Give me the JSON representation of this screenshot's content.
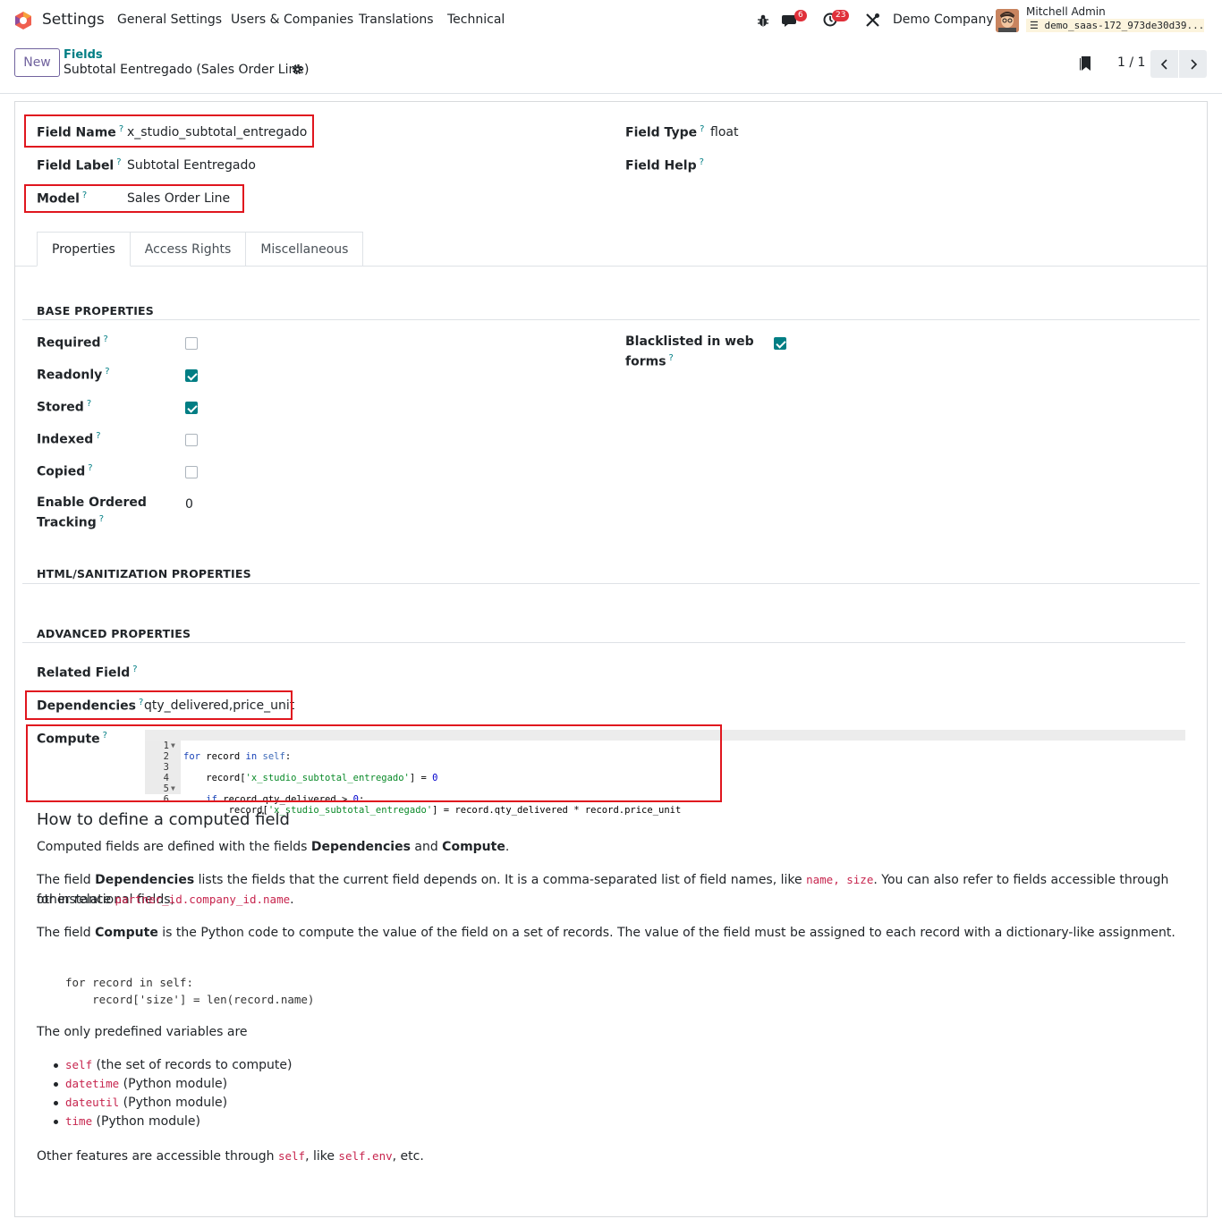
{
  "navbar": {
    "app_name": "Settings",
    "menu": [
      "General Settings",
      "Users & Companies",
      "Translations",
      "Technical"
    ],
    "chat_count": "6",
    "activity_count": "23",
    "company": "Demo Company",
    "user_name": "Mitchell Admin",
    "db_name": "demo_saas-172_973de30d39..."
  },
  "control": {
    "new_label": "New",
    "breadcrumb_parent": "Fields",
    "breadcrumb_current": "Subtotal Eentregado (Sales Order Line)",
    "pager": "1 / 1"
  },
  "form": {
    "field_name_label": "Field Name",
    "field_name": "x_studio_subtotal_entregado",
    "field_label_label": "Field Label",
    "field_label": "Subtotal Eentregado",
    "model_label": "Model",
    "model": "Sales Order Line",
    "field_type_label": "Field Type",
    "field_type": "float",
    "field_help_label": "Field Help"
  },
  "tabs": [
    "Properties",
    "Access Rights",
    "Miscellaneous"
  ],
  "base": {
    "title": "BASE PROPERTIES",
    "required": "Required",
    "readonly": "Readonly",
    "stored": "Stored",
    "indexed": "Indexed",
    "copied": "Copied",
    "tracking_l1": "Enable Ordered",
    "tracking_l2": "Tracking",
    "tracking_value": "0",
    "blacklist_l1": "Blacklisted in web",
    "blacklist_l2": "forms"
  },
  "html_title": "HTML/SANITIZATION PROPERTIES",
  "advanced": {
    "title": "ADVANCED PROPERTIES",
    "related_label": "Related Field",
    "dependencies_label": "Dependencies",
    "dependencies": "qty_delivered,price_unit",
    "compute_label": "Compute"
  },
  "code_lines": [
    "1",
    "2",
    "3",
    "4",
    "5",
    "6"
  ],
  "help": {
    "title": "How to define a computed field",
    "p1_a": "Computed fields are defined with the fields ",
    "p1_b": "Dependencies",
    "p1_c": " and ",
    "p1_d": "Compute",
    "p1_e": ".",
    "p2_a": "The field ",
    "p2_b": "Dependencies",
    "p2_c": " lists the fields that the current field depends on. It is a comma-separated list of field names, like ",
    "p2_code1": "name, size",
    "p2_d": ". You can also refer to fields accessible through other relational fields,",
    "p2_e": "for instance ",
    "p2_code2": "partner_id.company_id.name",
    "p2_f": ".",
    "p3_a": "The field ",
    "p3_b": "Compute",
    "p3_c": " is the Python code to compute the value of the field on a set of records. The value of the field must be assigned to each record with a dictionary-like assignment.",
    "pre1": "for record in self:",
    "pre2": "    record['size'] = len(record.name)",
    "p4": "The only predefined variables are",
    "li1_code": "self",
    "li1_text": " (the set of records to compute)",
    "li2_code": "datetime",
    "li2_text": " (Python module)",
    "li3_code": "dateutil",
    "li3_text": " (Python module)",
    "li4_code": "time",
    "li4_text": " (Python module)",
    "p5_a": "Other features are accessible through ",
    "p5_code1": "self",
    "p5_b": ", like ",
    "p5_code2": "self.env",
    "p5_c": ", etc."
  }
}
